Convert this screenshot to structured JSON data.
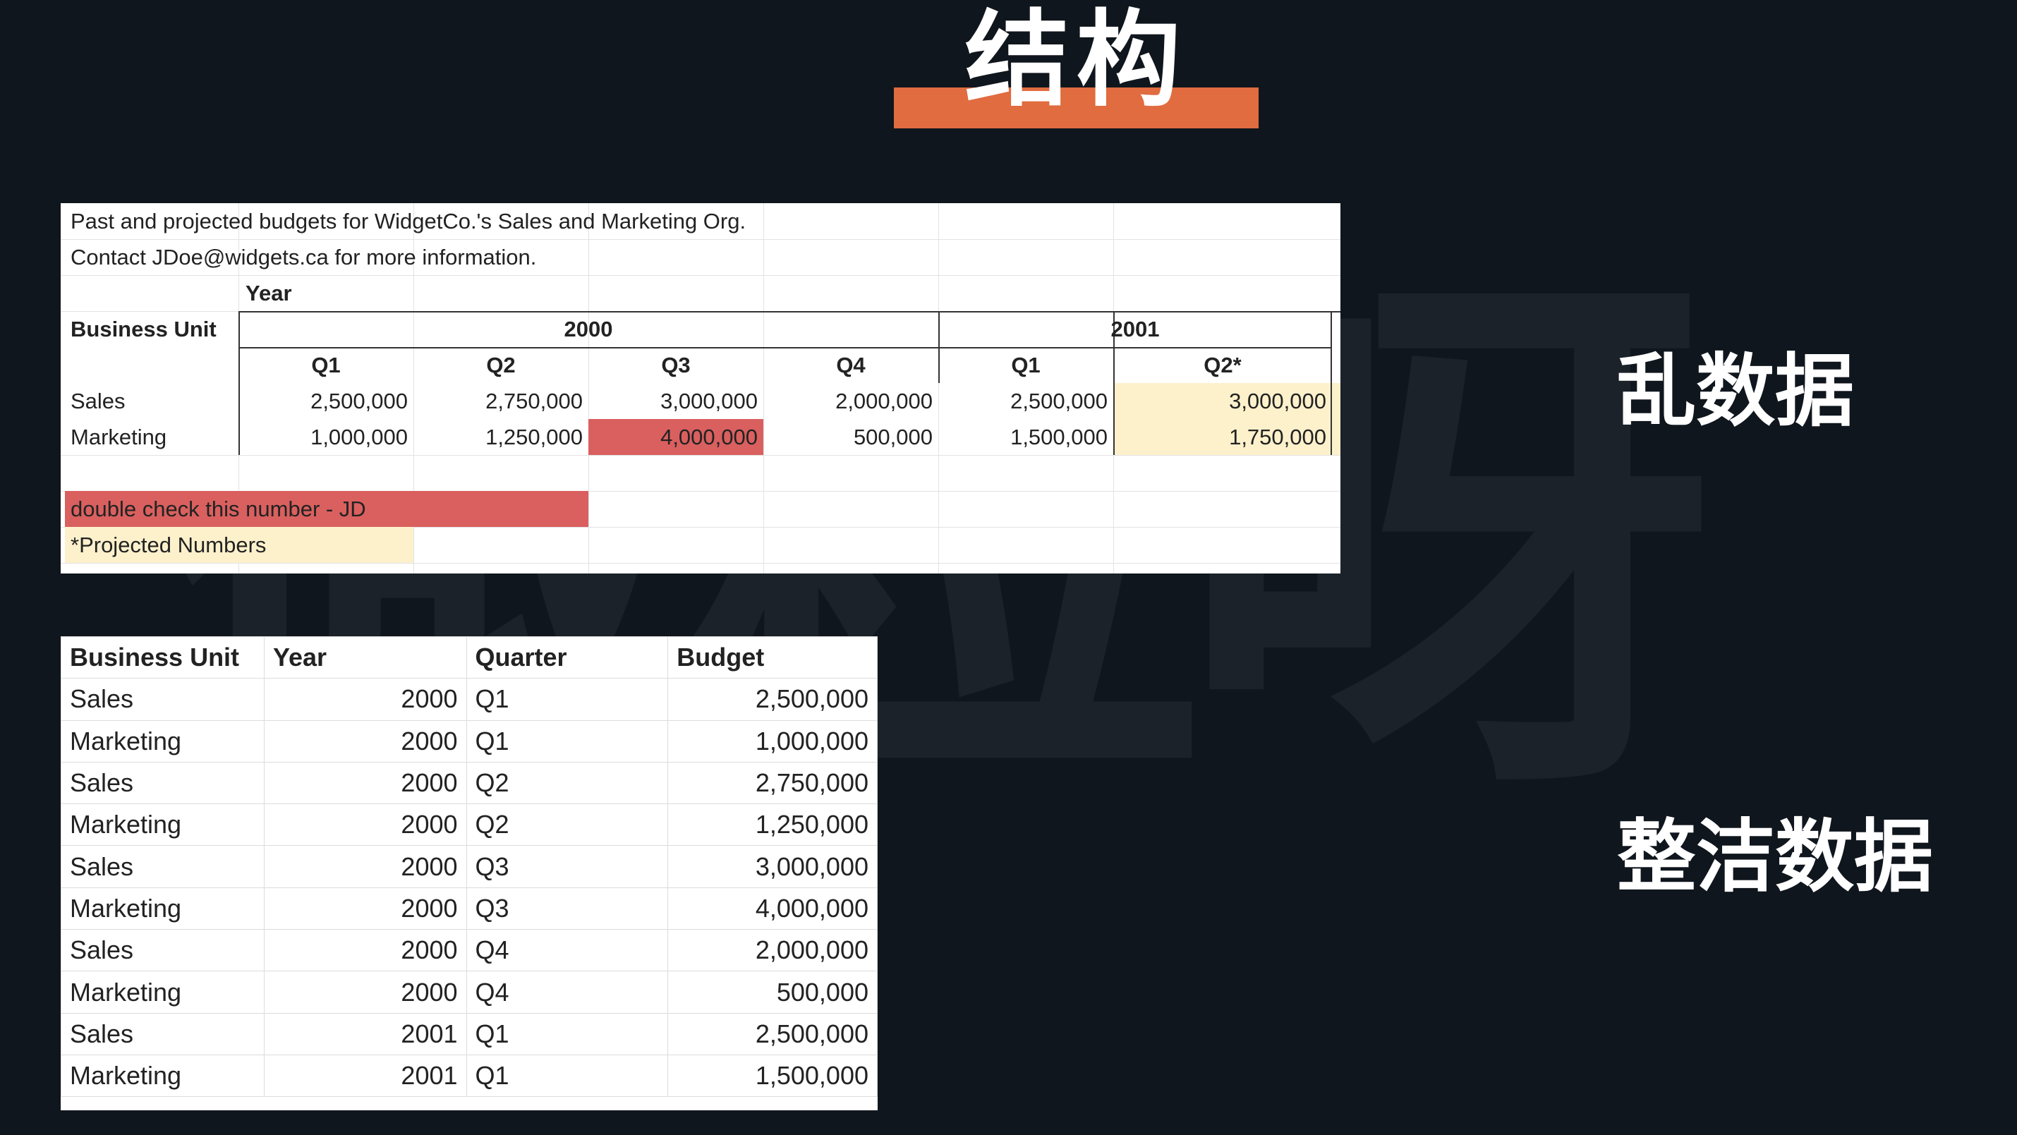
{
  "title": "结构",
  "labels": {
    "messy": "乱数据",
    "tidy": "整洁数据"
  },
  "watermark": "微粒呀",
  "colors": {
    "accent": "#e06c3f",
    "background": "#10161d",
    "flag_red": "#d9605f",
    "projected_yellow": "#fdf1cc"
  },
  "messy": {
    "note1": "Past and projected budgets for WidgetCo.'s Sales and Marketing Org.",
    "note2": "Contact JDoe@widgets.ca for more information.",
    "year_label": "Year",
    "business_unit_label": "Business Unit",
    "year_2000": "2000",
    "year_2001": "2001",
    "quarters": [
      "Q1",
      "Q2",
      "Q3",
      "Q4",
      "Q1",
      "Q2*"
    ],
    "rows": [
      {
        "unit": "Sales",
        "values": [
          "2,500,000",
          "2,750,000",
          "3,000,000",
          "2,000,000",
          "2,500,000",
          "3,000,000"
        ]
      },
      {
        "unit": "Marketing",
        "values": [
          "1,000,000",
          "1,250,000",
          "4,000,000",
          "500,000",
          "1,500,000",
          "1,750,000"
        ]
      }
    ],
    "check_note": "double check this number - JD",
    "projected_note": "*Projected Numbers"
  },
  "tidy": {
    "headers": [
      "Business Unit",
      "Year",
      "Quarter",
      "Budget"
    ],
    "rows": [
      [
        "Sales",
        "2000",
        "Q1",
        "2,500,000"
      ],
      [
        "Marketing",
        "2000",
        "Q1",
        "1,000,000"
      ],
      [
        "Sales",
        "2000",
        "Q2",
        "2,750,000"
      ],
      [
        "Marketing",
        "2000",
        "Q2",
        "1,250,000"
      ],
      [
        "Sales",
        "2000",
        "Q3",
        "3,000,000"
      ],
      [
        "Marketing",
        "2000",
        "Q3",
        "4,000,000"
      ],
      [
        "Sales",
        "2000",
        "Q4",
        "2,000,000"
      ],
      [
        "Marketing",
        "2000",
        "Q4",
        "500,000"
      ],
      [
        "Sales",
        "2001",
        "Q1",
        "2,500,000"
      ],
      [
        "Marketing",
        "2001",
        "Q1",
        "1,500,000"
      ]
    ]
  }
}
